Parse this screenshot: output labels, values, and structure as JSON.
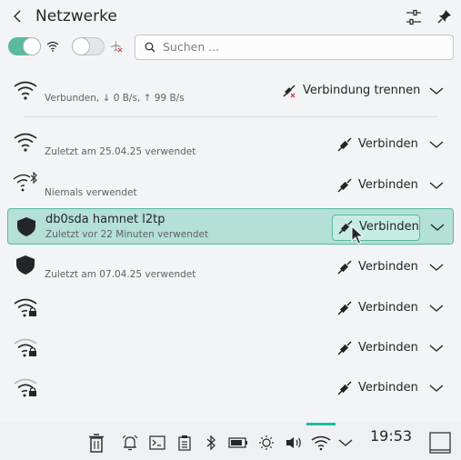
{
  "header": {
    "back_label": "<",
    "title": "Netzwerke"
  },
  "search": {
    "placeholder": "Suchen ..."
  },
  "toggles": {
    "wifi_enabled": true,
    "airplane_enabled": false
  },
  "connected": {
    "status": "Verbunden, ↓ 0 B/s, ↑ 99 B/s",
    "action": "Verbindung trennen"
  },
  "networks": [
    {
      "name": "",
      "subtitle": "Zuletzt am 25.04.25 verwendet",
      "action": "Verbinden",
      "icon": "wifi-icon"
    },
    {
      "name": "",
      "subtitle": "Niemals verwendet",
      "action": "Verbinden",
      "icon": "wifi-bluetooth-icon"
    },
    {
      "name": "db0sda hamnet l2tp",
      "subtitle": "Zuletzt vor 22 Minuten verwendet",
      "action": "Verbinden",
      "icon": "vpn-shield-icon"
    },
    {
      "name": "",
      "subtitle": "Zuletzt am 07.04.25 verwendet",
      "action": "Verbinden",
      "icon": "vpn-shield-icon"
    },
    {
      "name": "",
      "subtitle": "",
      "action": "Verbinden",
      "icon": "wifi-locked-icon"
    },
    {
      "name": "",
      "subtitle": "",
      "action": "Verbinden",
      "icon": "wifi-locked-weak-icon"
    },
    {
      "name": "",
      "subtitle": "",
      "action": "Verbinden",
      "icon": "wifi-locked-weak-icon"
    }
  ],
  "taskbar": {
    "clock": "19:53",
    "colors": {
      "active": "#1abc9c",
      "selection": "#b4e0d5"
    }
  }
}
